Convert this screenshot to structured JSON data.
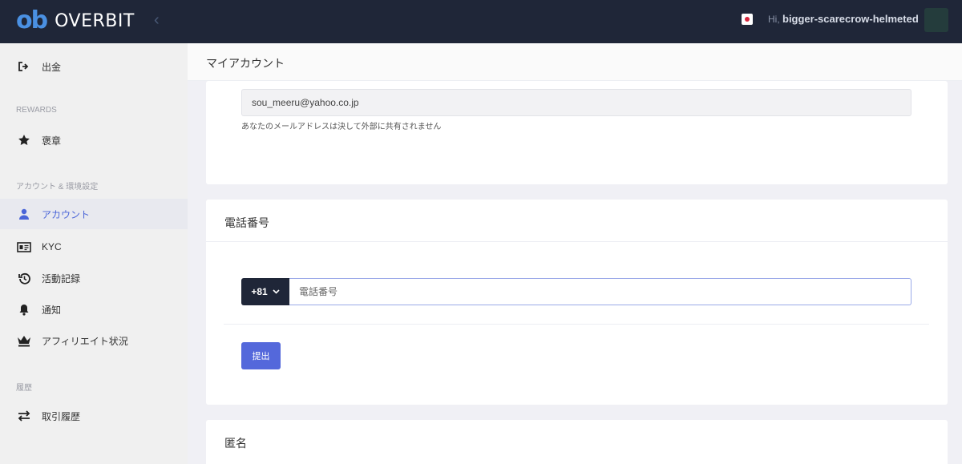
{
  "topbar": {
    "logo_mark": "ob",
    "logo_text": "OVERBIT",
    "collapse_icon": "‹",
    "greeting": "Hi,",
    "username": "bigger-scarecrow-helmeted"
  },
  "sidebar": {
    "items": [
      {
        "label": "出金",
        "icon": "sign-out-icon"
      },
      {
        "label": "褒章",
        "icon": "star-icon"
      },
      {
        "label": "アカウント",
        "icon": "user-icon"
      },
      {
        "label": "KYC",
        "icon": "id-card-icon"
      },
      {
        "label": "活動記録",
        "icon": "history-icon"
      },
      {
        "label": "通知",
        "icon": "bell-icon"
      },
      {
        "label": "アフィリエイト状況",
        "icon": "crown-icon"
      },
      {
        "label": "取引履歴",
        "icon": "exchange-icon"
      }
    ],
    "sections": {
      "rewards": "REWARDS",
      "account": "アカウント & 環境設定",
      "history": "履歴"
    }
  },
  "header": {
    "title": "マイアカウント"
  },
  "email_card": {
    "email": "sou_meeru@yahoo.co.jp",
    "help": "あなたのメールアドレスは決して外部に共有されません"
  },
  "phone_card": {
    "title": "電話番号",
    "country_code": "+81",
    "placeholder": "電話番号",
    "submit": "提出"
  },
  "anon_card": {
    "title": "匿名"
  },
  "colors": {
    "topbar": "#1f2638",
    "accent": "#5468db",
    "active": "#4a65d8"
  }
}
